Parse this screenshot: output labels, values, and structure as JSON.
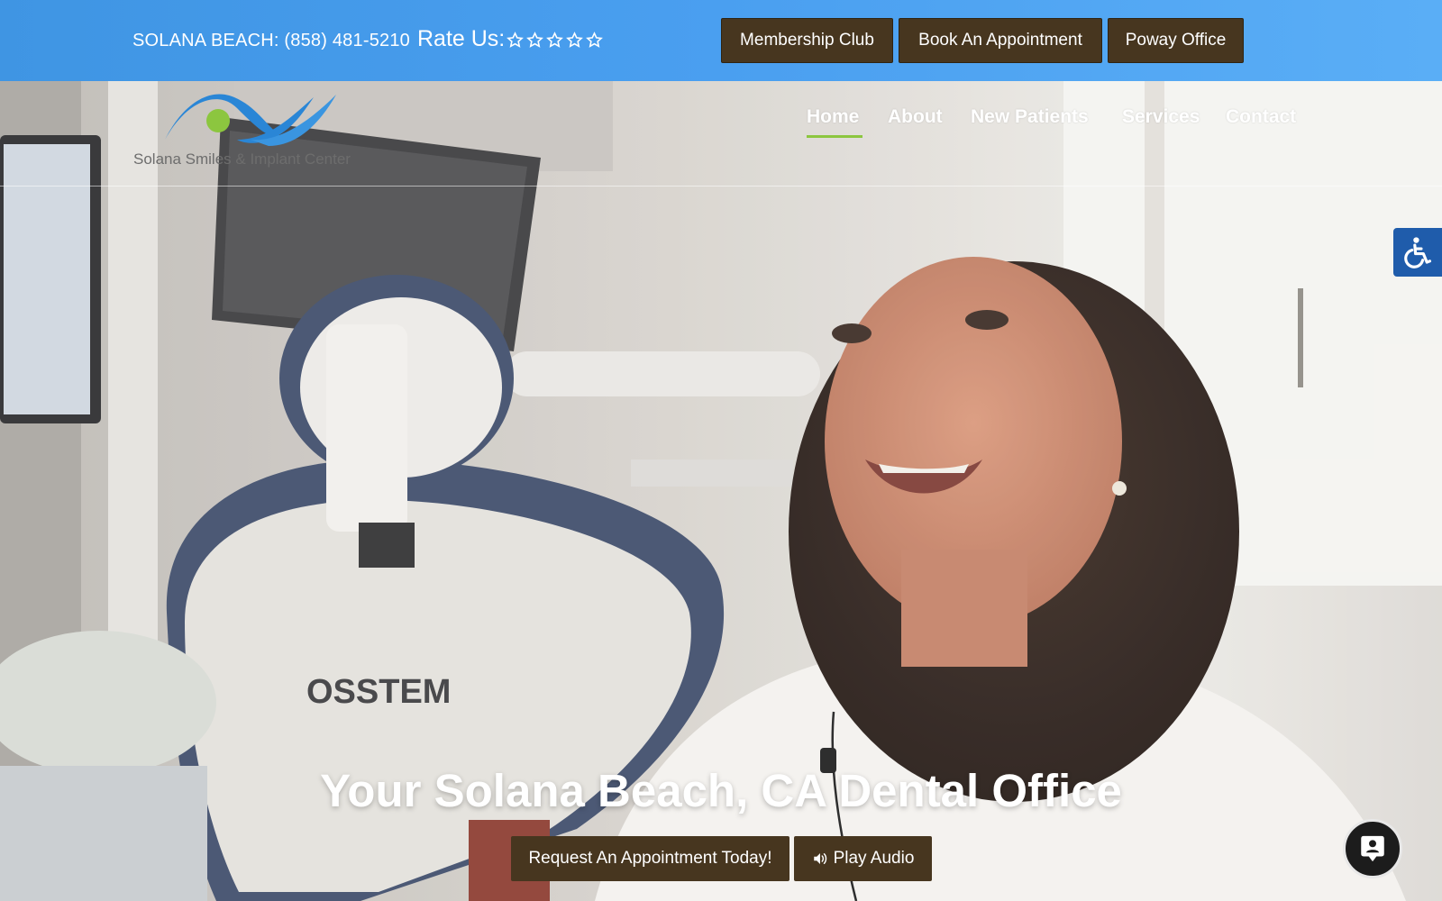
{
  "topbar": {
    "phone": "SOLANA BEACH: (858) 481-5210",
    "rate_label": "Rate Us:",
    "rating_stars": 5,
    "buttons": {
      "membership": "Membership Club",
      "book": "Book An Appointment",
      "poway": "Poway Office"
    },
    "gradient_colors": [
      "#3f95e3",
      "#5aaef6"
    ],
    "button_color": "#47361f"
  },
  "logo": {
    "text": "Solana Smiles & Implant Center",
    "icon": "wave-logo-icon",
    "colors": [
      "#2a86d6",
      "#8cc63f"
    ]
  },
  "nav": {
    "items": [
      "Home",
      "About",
      "New Patients",
      "Services",
      "Contact"
    ],
    "active": "Home",
    "active_underline_color": "#8cc63f"
  },
  "hero": {
    "headline": "Your Solana Beach, CA Dental Office",
    "request_button": "Request An Appointment Today!",
    "audio_button": "Play Audio",
    "audio_icon": "volume-icon",
    "chair_brand": "OSSTEM"
  },
  "widgets": {
    "accessibility_icon": "wheelchair-icon",
    "chat_icon": "chat-contact-icon"
  }
}
